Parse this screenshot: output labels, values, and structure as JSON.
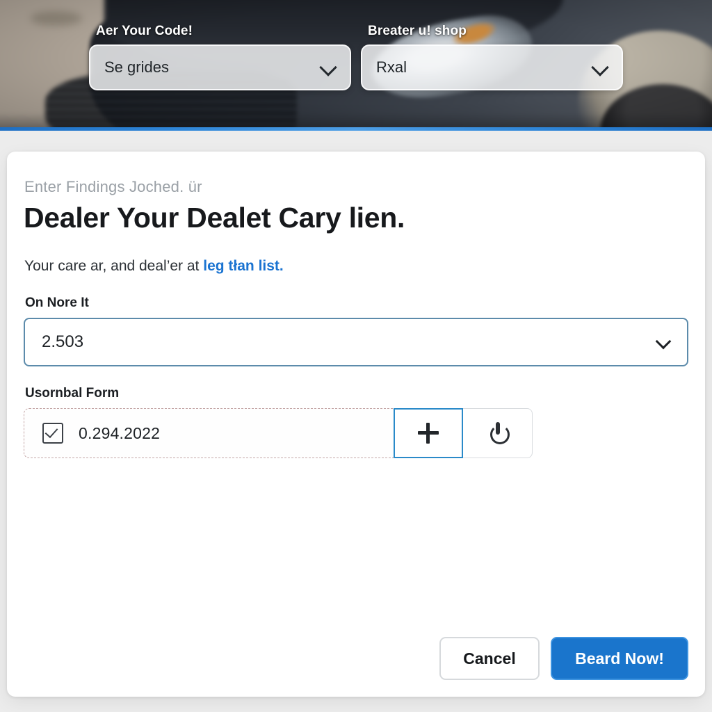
{
  "hero": {
    "fields": [
      {
        "label": "Aer Your Code!",
        "value": "Se grides",
        "icon": "chevron-down-icon"
      },
      {
        "label": "Breater u! shop",
        "value": "Rxal",
        "icon": "chevron-down-icon"
      }
    ]
  },
  "card": {
    "eyebrow": "Enter Findings Joched. ür",
    "title": "Dealer Your  Dealet Cary lien.",
    "subtitle_prefix": "Your care ar, and deal’er at ",
    "subtitle_link": "leg tłan list.",
    "select_field": {
      "label": "On Nore It",
      "value": "2.503",
      "icon": "chevron-down-icon"
    },
    "combo_field": {
      "label": "Usornbal Form",
      "value": "0.294.2022",
      "checkbox_icon": "checked-checkbox-icon",
      "add_icon": "plus-icon",
      "power_icon": "power-icon"
    },
    "footer": {
      "cancel_label": "Cancel",
      "primary_label": "Beard Now!"
    }
  },
  "colors": {
    "accent_blue": "#1a75cc",
    "link_blue": "#1a73d1",
    "rule_blue": "#2f86d8",
    "select_border": "#5c8bab",
    "combo_focus_border": "#2a8ac9",
    "combo_dashed_border": "#c4a6a6",
    "eyebrow_grey": "#9aa0a6"
  }
}
